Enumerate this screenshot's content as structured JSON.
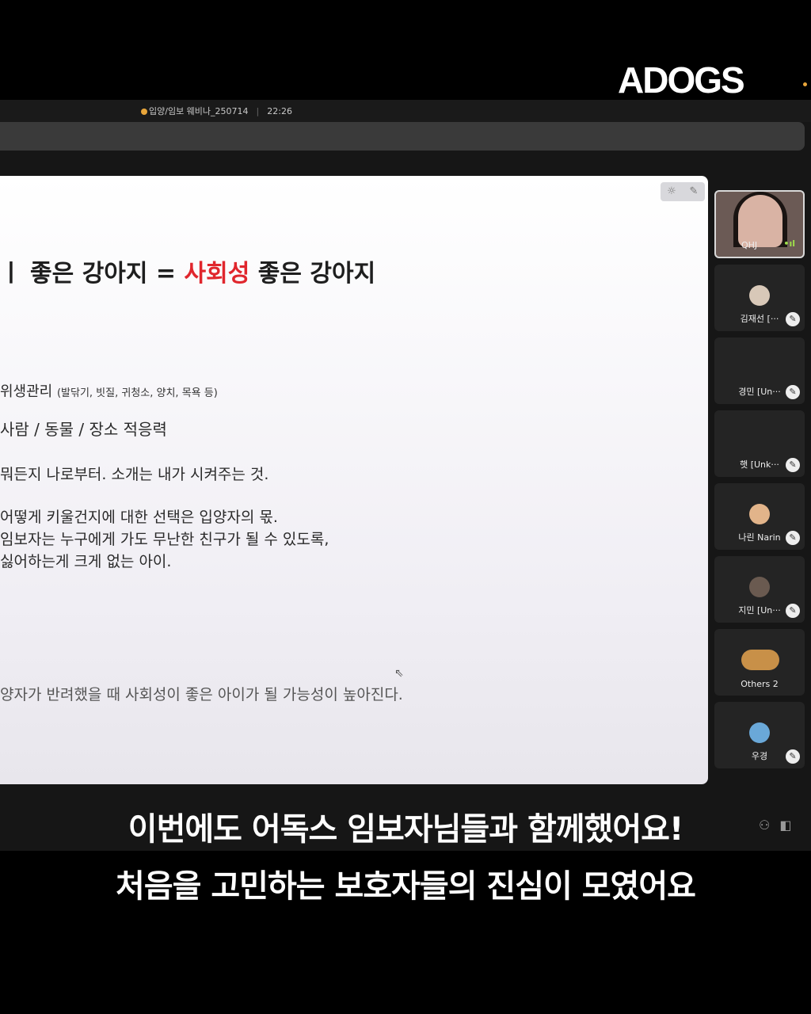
{
  "brand": {
    "logo_text": "ADOGS",
    "dot_color": "#e8a53a"
  },
  "meeting": {
    "title": "입양/임보 웨비나_250714",
    "time": "22:26"
  },
  "slide": {
    "tools": {
      "left_icon": "☼",
      "right_icon": "✎"
    },
    "title_before": "ㅣ 좋은 강아지 = ",
    "title_highlight": "사회성",
    "title_after": " 좋은 강아지",
    "lines": [
      {
        "text": "위생관리 ",
        "note": "(발닦기, 빗질, 귀청소, 양치, 목욕 등)"
      },
      {
        "text": "사람 / 동물 / 장소 적응력",
        "note": ""
      },
      {
        "text": "뭐든지 나로부터. 소개는 내가 시켜주는 것.",
        "note": ""
      },
      {
        "text": "어떻게 키울건지에 대한 선택은 입양자의 몫.",
        "note": ""
      },
      {
        "text": "임보자는 누구에게 가도 무난한 친구가 될 수 있도록,",
        "note": ""
      },
      {
        "text": "싫어하는게 크게 없는 아이.",
        "note": ""
      },
      {
        "text": "양자가 반려했을 때 사회성이 좋은 아이가 될 가능성이 높아진다.",
        "note": ""
      }
    ],
    "cursor_icon": "⇖"
  },
  "participants": [
    {
      "name": "QHJ",
      "type": "video",
      "mic": "speaking"
    },
    {
      "name": "김재선 [···",
      "type": "avatar",
      "avatar_color": "#d8c8b8"
    },
    {
      "name": "경민 [Un···",
      "type": "blank"
    },
    {
      "name": "햇 [Unk···",
      "type": "blank"
    },
    {
      "name": "나린 Narin",
      "type": "avatar",
      "avatar_color": "#e2b48a"
    },
    {
      "name": "지민 [Un···",
      "type": "avatar",
      "avatar_color": "#6a5a50"
    },
    {
      "name": "Others 2",
      "type": "pair",
      "avatar_color": "#c89048"
    },
    {
      "name": "우경",
      "type": "avatar",
      "avatar_color": "#6aa8d8"
    }
  ],
  "mic_icon": "✎",
  "speaking_icon": "•ıl",
  "bottom_icons": {
    "person": "⚇",
    "panel": "◧"
  },
  "subtitles": {
    "line1": "이번에도 어독스 임보자님들과 함께했어요!",
    "line2": "처음을 고민하는 보호자들의 진심이 모였어요"
  }
}
